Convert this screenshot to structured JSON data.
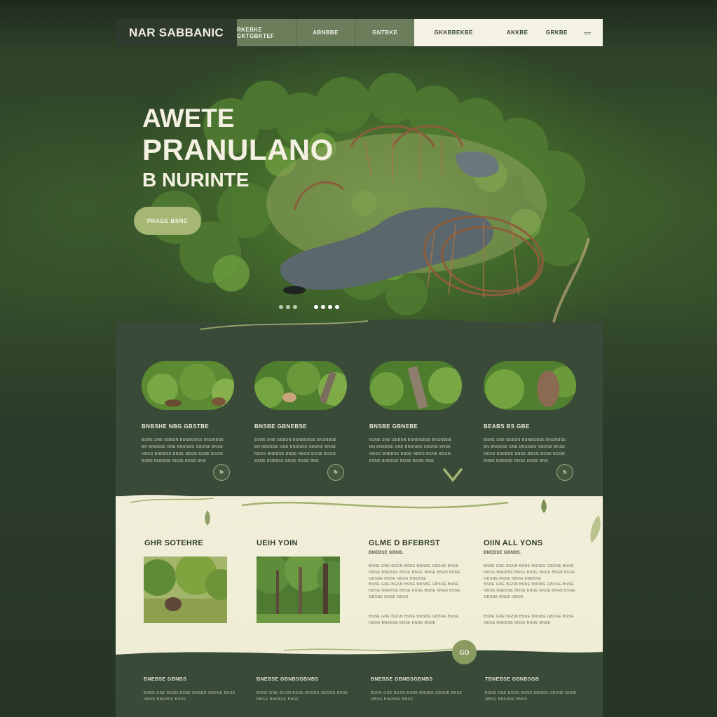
{
  "nav": {
    "brand": "NAR SABBANIC",
    "links": [
      "RKEBKE GKTGBKTEF",
      "ABNBBE",
      "GNTBKE"
    ],
    "right_links": [
      "GKKBBEKBE",
      "AKKBE",
      "GRKBE"
    ],
    "menu_icon": "hamburger-icon"
  },
  "hero": {
    "line1": "AWETE",
    "line2": "PRANULANO",
    "line3": "B  NURINTE",
    "cta": "PRAGE BSNC",
    "slides": 7,
    "active_slide": 5
  },
  "cards": [
    {
      "title": "BNBSHE NBG GBSTBE",
      "text": "BSNE SNE GEBSN BSNBGBSE BNSNBSE BN BNEBSE GNE BNSNBG GBSNE BNSE NBSG BNEBSE BNSE NBSG BSNE BGSN BSNE BNEBSE BNSE BNSE BNE",
      "icon": "circle-arrow-icon"
    },
    {
      "title": "BNSBE GBNEBSE",
      "text": "BSNE SNE GEBSN BSNBGBSE BNSNBSE BN BNEBSE GNE BNSNBG GBSNE BNSE NBSG BNEBSE BNSE NBSG BSNE BGSN BSNE BNEBSE BNSE BNSE BNE",
      "icon": "circle-arrow-icon"
    },
    {
      "title": "BNSBE GBNEBE",
      "text": "BSNE SNE GEBSN BSNBGBSE BNSNBSE BN BNEBSE GNE BNSNBG GBSNE BNSE NBSG BNEBSE BNSE NBSG BSNE BGSN BSNE BNEBSE BNSE BNSE BNE",
      "icon": "chevron-down-icon"
    },
    {
      "title": "BEABS BS GBE",
      "text": "BSNE SNE GEBSN BSNBGBSE BNSNBSE BN BNEBSE GNE BNSNBG GBSNE BNSE NBSG BNEBSE BNSE NBSG BSNE BGSN BSNE BNEBSE BNSE BNSE BNE",
      "icon": "circle-arrow-icon"
    }
  ],
  "columns": [
    {
      "title": "GHR SOTEHRE"
    },
    {
      "title": "UEIH YOIN"
    },
    {
      "title": "GLME D BFEBRST",
      "sub": "BNEBSE GBNB.",
      "paragraphs": [
        "BSNE GNE BGSN BSNE BNSBG GBSNE BNSE NBSG BNEBSE BNSE BNSE BNSE BNEB BSNE GBSNE BNSE NBSG BNEBSE",
        "BSNE GNE BGSN BSNE BNSBG GBSNE BNSE NBSG BNEBSE BNSE BNSE BNSE BNEB BSNE GBSNE BNSE NBSG",
        "BSNE GNE BGSN BSNE BNSBG GBSNE BNSE NBSG BNEBSE BNSE BNSE BNSE"
      ]
    },
    {
      "title": "OIIN ALL YONS",
      "sub": "BNEBSE GBNBS.",
      "paragraphs": [
        "BSNE GNE BGSN BSNE BNSBG GBSNE BNSE NBSG BNEBSE BNSE BNSE BNSE BNEB BSNE GBSNE BNSE NBSG BNEBSE",
        "BSNE GNE BGSN BSNE BNSBG GBSNE BNSE NBSG BNEBSE BNSE BNSE BNSE BNEB BSNE GBSNE BNSE NBSG",
        "BSNE GNE BGSN BSNE BNSBG GBSNE BNSE NBSG BNEBSE BNSE BNSE BNSE"
      ]
    }
  ],
  "bottom_button": "GO",
  "footer": [
    {
      "title": "BNEBSE GBNBS",
      "text": "BSNE GNE BGSN BSNE BNSBG GBSNE BNSE NBSG BNEBSE BNSE"
    },
    {
      "title": "BNEBSE GBNBSGBNBS",
      "text": "BSNE GNE BGSN BSNE BNSBG GBSNE BNSE NBSG BNEBSE BNSE"
    },
    {
      "title": "BNEBSE GBNBSGBNBS",
      "text": "BSNE GNE BGSN BSNE BNSBG GBSNE BNSE NBSG BNEBSE BNSE"
    },
    {
      "title": "TBNEBSE GBNBSGB",
      "text": "BSNE GNE BGSN BSNE BNSBG GBSNE BNSE NBSG BNEBSE BNSE"
    }
  ],
  "colors": {
    "dark_green": "#3a4a38",
    "accent_green": "#a6b775",
    "cream": "#f1efd9",
    "nav_mid": "#6b7d5b"
  }
}
